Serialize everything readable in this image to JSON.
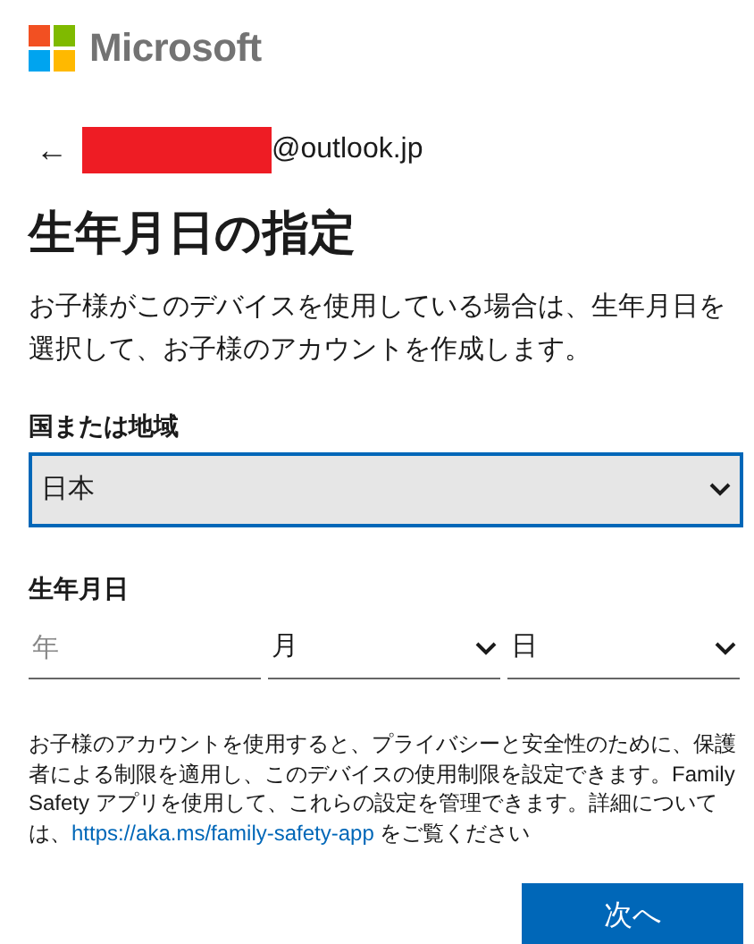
{
  "logo": {
    "text": "Microsoft"
  },
  "account": {
    "back": "←",
    "email_suffix": "@outlook.jp"
  },
  "title": "生年月日の指定",
  "description": "お子様がこのデバイスを使用している場合は、生年月日を選択して、お子様のアカウントを作成します。",
  "country": {
    "label": "国または地域",
    "value": "日本",
    "focused": true
  },
  "birthdate": {
    "label": "生年月日",
    "year": {
      "placeholder": "年"
    },
    "month": {
      "value": "月"
    },
    "day": {
      "value": "日"
    }
  },
  "notice": {
    "text": "お子様のアカウントを使用すると、プライバシーと安全性のために、保護者による制限を適用し、このデバイスの使用制限を設定できます。Family Safety アプリを使用して、これらの設定を管理できます。詳細については、",
    "link": "https://aka.ms/family-safety-app",
    "suffix": " をご覧ください"
  },
  "buttons": [
    {
      "label": "次へ"
    }
  ]
}
